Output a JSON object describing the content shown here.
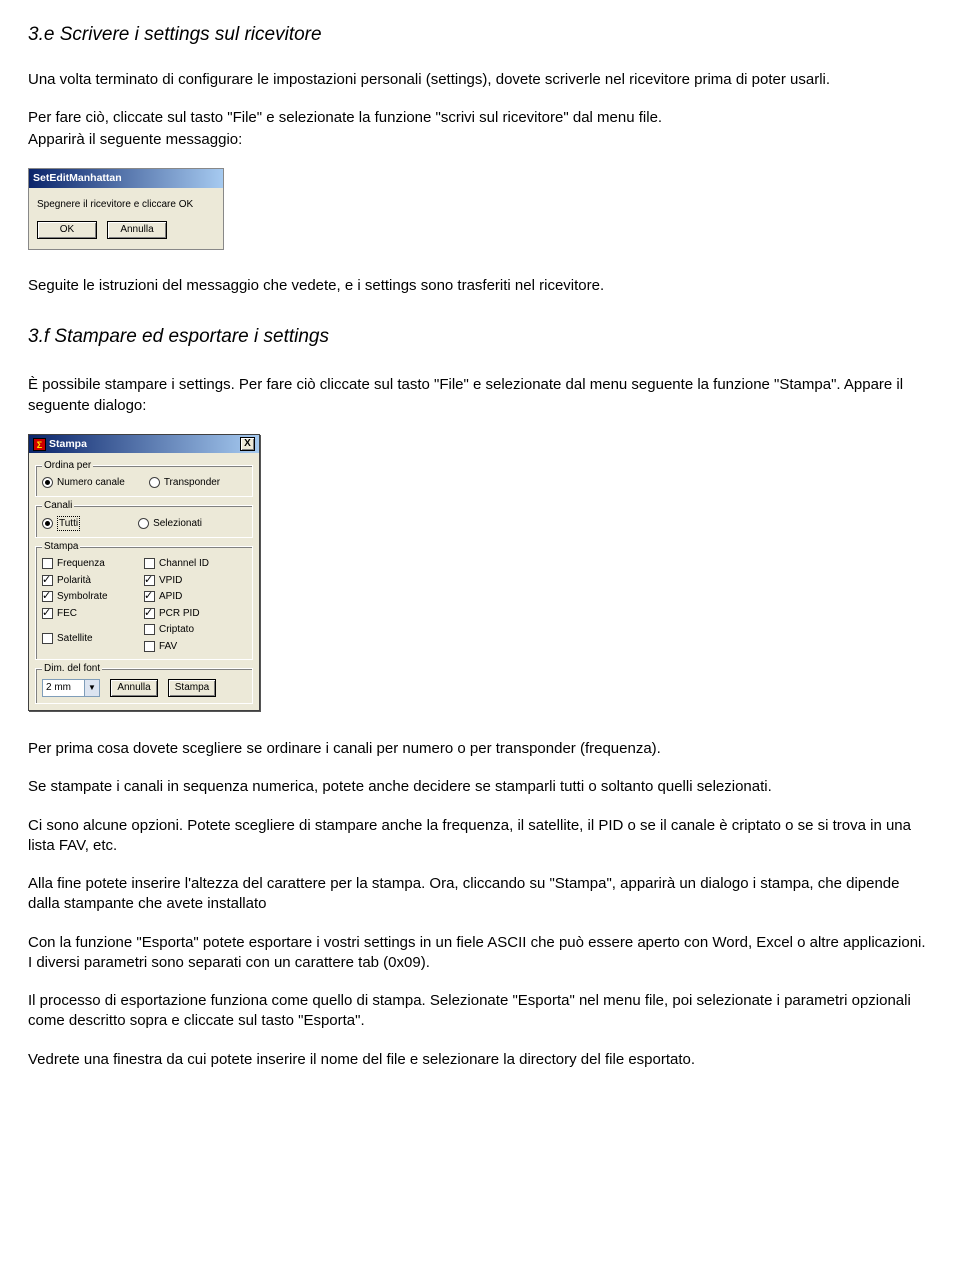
{
  "h1": "3.e Scrivere i settings sul ricevitore",
  "p1": "Una volta terminato di configurare le impostazioni personali (settings), dovete scriverle nel ricevitore prima di poter usarli.",
  "p2": "Per fare ciò, cliccate sul tasto \"File\" e selezionate la funzione \"scrivi sul ricevitore\" dal menu file.",
  "p3": "Apparirà il seguente messaggio:",
  "dlg1": {
    "title": "SetEditManhattan",
    "body": "Spegnere il ricevitore e cliccare OK",
    "ok": "OK",
    "cancel": "Annulla"
  },
  "p4": "Seguite le istruzioni del messaggio che vedete, e i settings sono trasferiti nel ricevitore.",
  "h2": "3.f Stampare ed esportare i settings",
  "p5": "È possibile stampare i settings. Per fare ciò cliccate sul tasto \"File\" e selezionate dal menu seguente la funzione \"Stampa\". Appare il seguente dialogo:",
  "dlg2": {
    "title": "Stampa",
    "icon": "Σ",
    "close": "X",
    "grp_ordina": "Ordina per",
    "r_numero": "Numero canale",
    "r_transponder": "Transponder",
    "grp_canali": "Canali",
    "r_tutti": "Tutti",
    "r_selez": "Selezionati",
    "grp_stampa": "Stampa",
    "c_freq": "Frequenza",
    "c_pol": "Polarità",
    "c_sym": "Symbolrate",
    "c_fec": "FEC",
    "c_sat": "Satellite",
    "c_chid": "Channel ID",
    "c_vpid": "VPID",
    "c_apid": "APID",
    "c_pcr": "PCR PID",
    "c_crip": "Criptato",
    "c_fav": "FAV",
    "grp_dim": "Dim. del font",
    "sel_val": "2 mm",
    "btn_ann": "Annulla",
    "btn_stampa": "Stampa"
  },
  "p6": "Per prima cosa dovete scegliere se ordinare i canali per numero o per transponder (frequenza).",
  "p7": "Se stampate i canali in sequenza numerica, potete anche decidere se stamparli tutti o soltanto quelli selezionati.",
  "p8": "Ci sono alcune opzioni. Potete scegliere di stampare anche la frequenza, il satellite, il PID o se il canale è criptato o se si trova in una lista FAV, etc.",
  "p9": "Alla fine potete inserire l'altezza del carattere per la stampa. Ora, cliccando su \"Stampa\", apparirà un dialogo i stampa, che dipende dalla stampante che avete installato",
  "p10": "Con la funzione \"Esporta\" potete esportare i vostri settings in un fiele ASCII che può essere aperto con Word, Excel o altre applicazioni. I diversi parametri sono separati con un carattere tab (0x09).",
  "p11": "Il processo di esportazione funziona come quello di stampa. Selezionate \"Esporta\" nel menu file, poi selezionate i parametri opzionali come descritto sopra e cliccate sul tasto \"Esporta\".",
  "p12": "Vedrete una finestra da cui potete inserire il nome del file e selezionare la directory del file esportato."
}
